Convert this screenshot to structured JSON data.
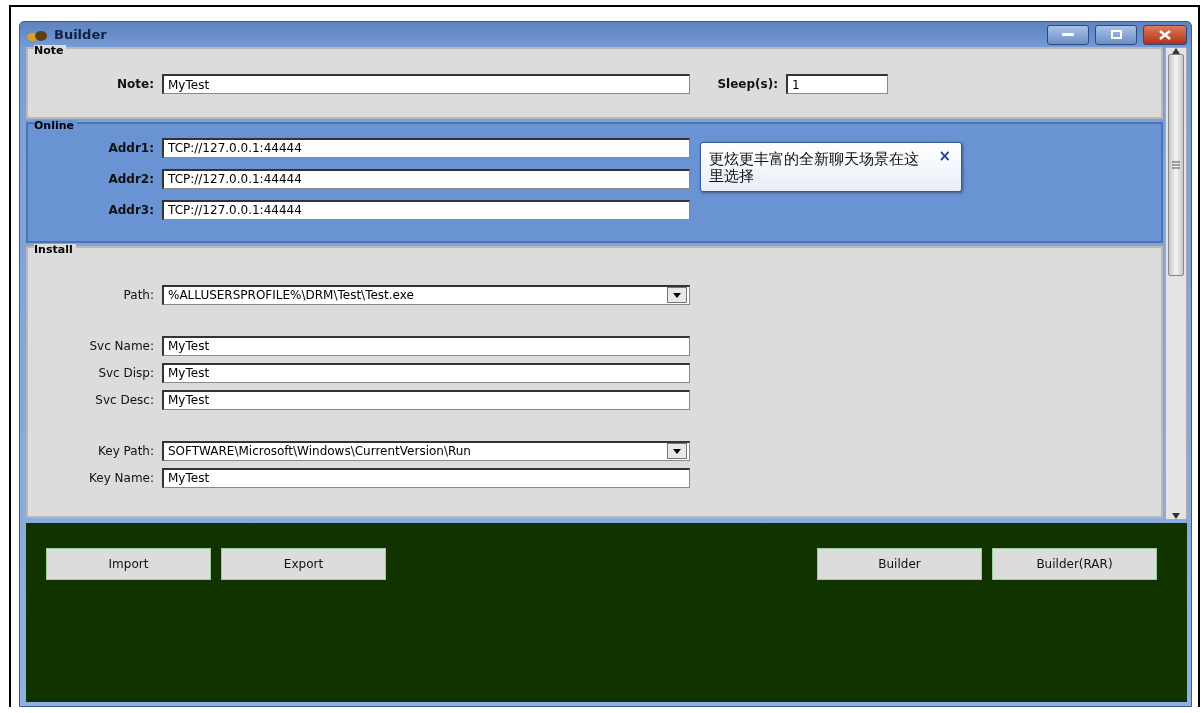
{
  "window": {
    "title": "Builder"
  },
  "note_group": {
    "title": "Note",
    "note": {
      "label": "Note:",
      "value": "MyTest"
    },
    "sleep": {
      "label": "Sleep(s):",
      "value": "1"
    }
  },
  "online_group": {
    "title": "Online",
    "fields": [
      {
        "label": "Addr1:",
        "value": "TCP://127.0.0.1:44444"
      },
      {
        "label": "Addr2:",
        "value": "TCP://127.0.0.1:44444"
      },
      {
        "label": "Addr3:",
        "value": "TCP://127.0.0.1:44444"
      }
    ]
  },
  "install_group": {
    "title": "Install",
    "sets": [
      [
        {
          "label": "Path:",
          "value": "%ALLUSERSPROFILE%\\DRM\\Test\\Test.exe",
          "kind": "combo"
        }
      ],
      [
        {
          "label": "Svc Name:",
          "value": "MyTest",
          "kind": "text"
        },
        {
          "label": "Svc Disp:",
          "value": "MyTest",
          "kind": "text"
        },
        {
          "label": "Svc Desc:",
          "value": "MyTest",
          "kind": "text"
        }
      ],
      [
        {
          "label": "Key Path:",
          "value": "SOFTWARE\\Microsoft\\Windows\\CurrentVersion\\Run",
          "kind": "combo"
        },
        {
          "label": "Key Name:",
          "value": "MyTest",
          "kind": "text"
        }
      ]
    ]
  },
  "tooltip": {
    "text": "更炫更丰富的全新聊天场景在这里选择",
    "close": "×"
  },
  "buttons_left": [
    "Import",
    "Export"
  ],
  "buttons_right": [
    "Builder",
    "Builder(RAR)"
  ]
}
